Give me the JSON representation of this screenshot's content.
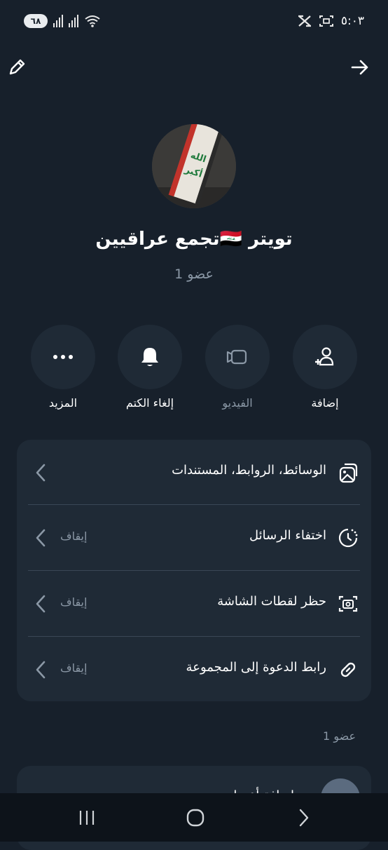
{
  "status_bar": {
    "battery": "٦٨",
    "time": "٥:٠٣"
  },
  "header": {
    "edit_icon": "pencil-icon",
    "forward_icon": "arrow-right-icon"
  },
  "group": {
    "name": "تجمع عراقيين🇮🇶 تويتر",
    "members": "1 عضو"
  },
  "actions": [
    {
      "label": "إضافة",
      "icon": "add-user-icon",
      "enabled": true
    },
    {
      "label": "الفيديو",
      "icon": "video-icon",
      "enabled": false
    },
    {
      "label": "إلغاء الكتم",
      "icon": "bell-icon",
      "enabled": true
    },
    {
      "label": "المزيد",
      "icon": "more-icon",
      "enabled": true
    }
  ],
  "settings": [
    {
      "label": "الوسائط، الروابط، المستندات",
      "value": "",
      "icon": "media-icon"
    },
    {
      "label": "اختفاء الرسائل",
      "value": "إيقاف",
      "icon": "timer-icon"
    },
    {
      "label": "حظر لقطات الشاشة",
      "value": "إيقاف",
      "icon": "screenshot-icon"
    },
    {
      "label": "رابط الدعوة إلى المجموعة",
      "value": "إيقاف",
      "icon": "link-icon"
    }
  ],
  "members_section": {
    "header": "1 عضو",
    "partial_label": "إضافة أعضاء"
  },
  "colors": {
    "background": "#17202b",
    "card": "#1f2a36",
    "muted_text": "#8b98a6"
  }
}
